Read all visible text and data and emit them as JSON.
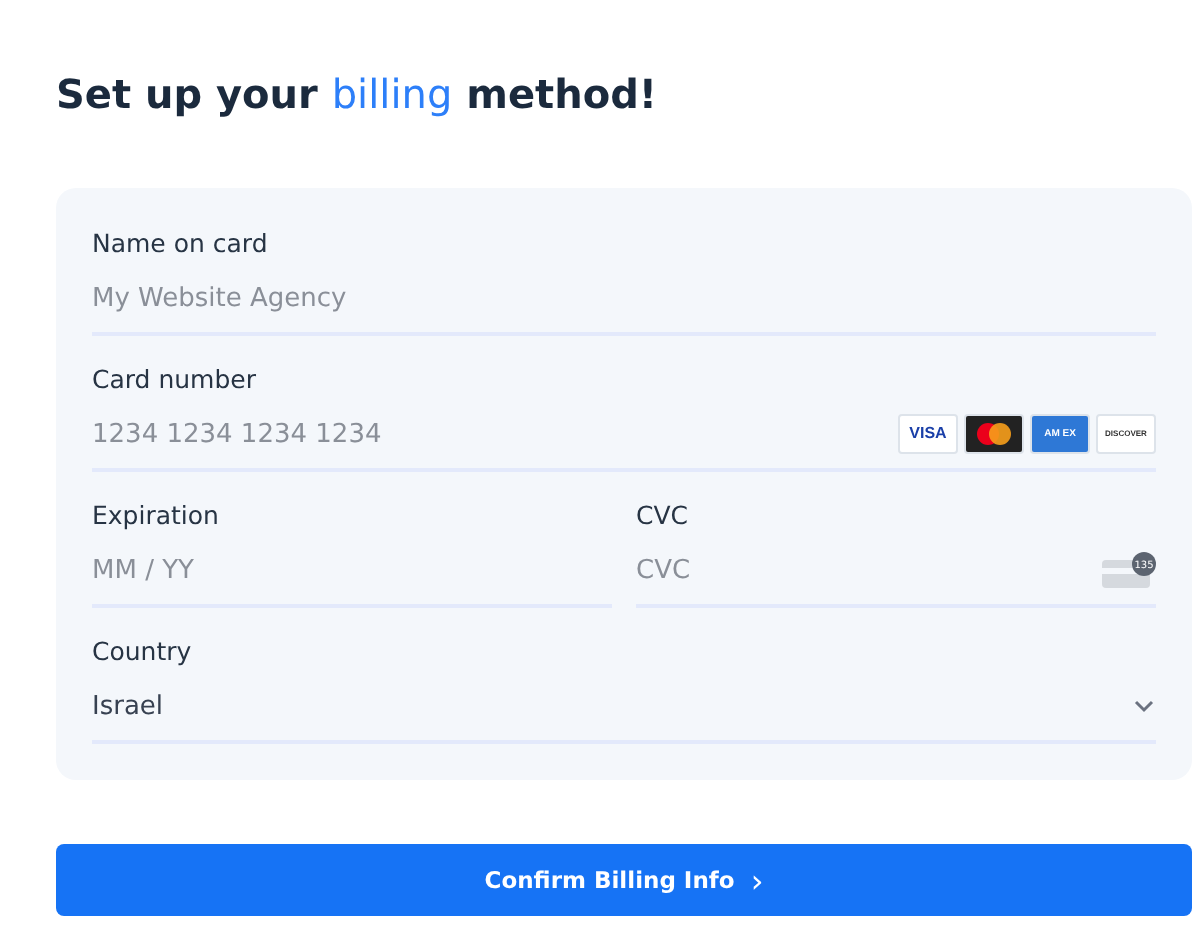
{
  "heading": {
    "before": "Set up your",
    "highlight": "billing",
    "after": "method!"
  },
  "fields": [
    {
      "kind": "text",
      "label": "Name on card",
      "placeholder": "My Website Agency"
    },
    {
      "kind": "card",
      "label": "Card number",
      "placeholder": "1234 1234 1234 1234",
      "brands": [
        {
          "kind": "visa",
          "label": "VISA"
        },
        {
          "kind": "mastercard"
        },
        {
          "kind": "amex",
          "label": "AM EX"
        },
        {
          "kind": "discover",
          "label": "DISCOVER"
        }
      ]
    },
    {
      "kind": "half",
      "label": "Expiration",
      "placeholder": "MM / YY"
    },
    {
      "kind": "cvc",
      "label": "CVC",
      "placeholder": "CVC",
      "hint": "135"
    },
    {
      "kind": "select",
      "label": "Country",
      "value": "Israel"
    }
  ],
  "submit": {
    "label": "Confirm Billing Info",
    "arrow": "›"
  }
}
